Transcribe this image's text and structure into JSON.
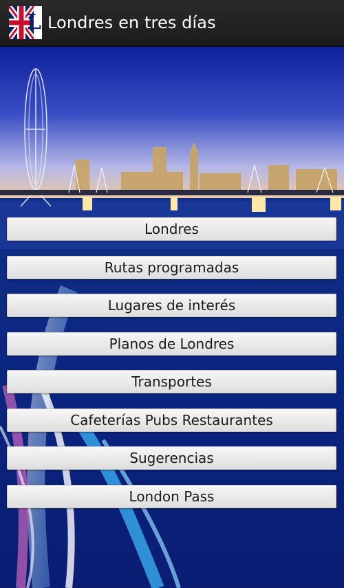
{
  "app": {
    "title": "Londres en tres días",
    "icon": "london-app-icon",
    "icon_letter": "L"
  },
  "menu": {
    "items": [
      {
        "label": "Londres"
      },
      {
        "label": "Rutas programadas"
      },
      {
        "label": "Lugares de interés"
      },
      {
        "label": "Planos de Londres"
      },
      {
        "label": "Transportes"
      },
      {
        "label": "Cafeterías Pubs Restaurantes"
      },
      {
        "label": "Sugerencias"
      },
      {
        "label": "London Pass"
      }
    ]
  },
  "colors": {
    "action_bar": "#222222",
    "background": "#0b1f7a",
    "button": "#eeeeee",
    "button_text": "#1a1a1a"
  }
}
